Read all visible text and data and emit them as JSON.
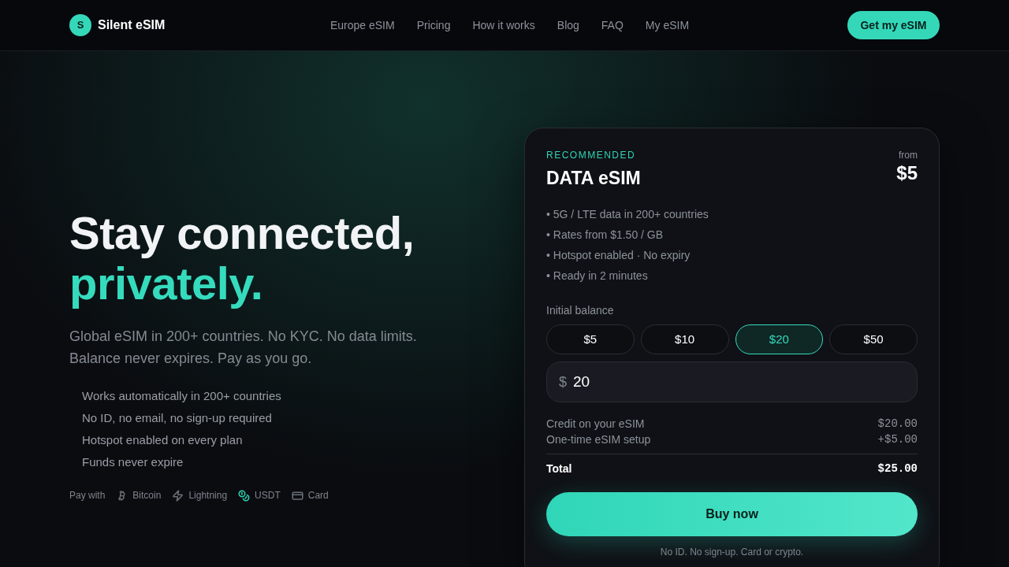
{
  "nav": {
    "logo_letter": "S",
    "brand": "Silent eSIM",
    "links": [
      "Europe eSIM",
      "Pricing",
      "How it works",
      "Blog",
      "FAQ",
      "My eSIM"
    ],
    "cta": "Get my eSIM"
  },
  "hero": {
    "headline": "Stay connected,",
    "headline_accent": "privately.",
    "subtitle": "Global eSIM in 200+ countries. No KYC. No data limits. Balance never expires. Pay as you go.",
    "features": [
      "Works automatically in 200+ countries",
      "No ID, no email, no sign-up required",
      "Hotspot enabled on every plan",
      "Funds never expire"
    ],
    "pay_label": "Pay with",
    "payment_methods": [
      {
        "kind": "bitcoin",
        "label": "Bitcoin",
        "color": "#6b7079"
      },
      {
        "kind": "lightning",
        "label": "Lightning",
        "color": "#6b7079"
      },
      {
        "kind": "coins",
        "label": "USDT",
        "color": "#2fd4b4"
      },
      {
        "kind": "card",
        "label": "Card",
        "color": "#6b7079"
      }
    ]
  },
  "plan_card": {
    "tag": "RECOMMENDED",
    "title": "DATA eSIM",
    "price_prefix": "from",
    "price": "$5",
    "features": [
      "• 5G / LTE data in 200+ countries",
      "• Rates from $1.50 / GB",
      "• Hotspot enabled · No expiry",
      "• Ready in 2 minutes"
    ],
    "balance_label": "Initial balance",
    "amounts": [
      {
        "label": "$5",
        "selected": false
      },
      {
        "label": "$10",
        "selected": false
      },
      {
        "label": "$20",
        "selected": true
      },
      {
        "label": "$50",
        "selected": false
      }
    ],
    "amount_field": {
      "currency": "$",
      "value": "20"
    },
    "lines": [
      {
        "label": "Credit on your eSIM",
        "value": "$20.00"
      },
      {
        "label": "One-time eSIM setup",
        "value": "+$5.00"
      }
    ],
    "total": {
      "label": "Total",
      "value": "$25.00"
    },
    "buy_button": "Buy now",
    "footnote": "No ID. No sign-up. Card or crypto."
  }
}
